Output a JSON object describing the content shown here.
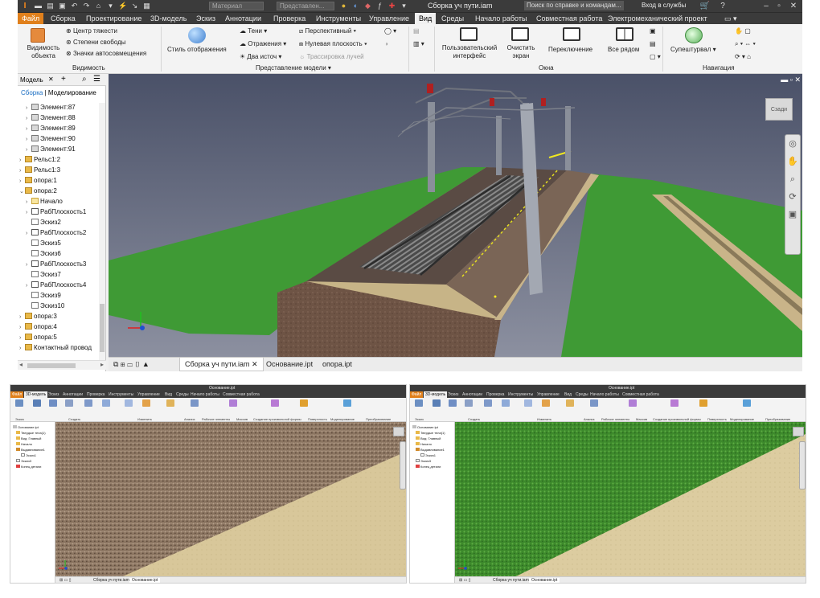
{
  "app": {
    "doc_title": "Сборка уч пути.iam",
    "search_placeholder": "Поиск по справке и командам...",
    "login": "Вход в службы",
    "material_dd": "Материал",
    "appearance_dd": "Представлен..."
  },
  "tabs": [
    "Файл",
    "Сборка",
    "Проектирование",
    "3D-модель",
    "Эскиз",
    "Аннотации",
    "Проверка",
    "Инструменты",
    "Управление",
    "Вид",
    "Среды",
    "Начало работы",
    "Совместная работа",
    "Электромеханический проект"
  ],
  "ribbon": {
    "visibility_object": "Видимость\nобъекта",
    "center_gravity": "Центр тяжести",
    "dof": "Степени свободы",
    "dof_icons": "Значки автосовмещения",
    "visibility_group": "Видимость",
    "display_style": "Стиль отображения",
    "shadows": "Тени",
    "reflections": "Отражения",
    "two_light": "Два источ",
    "perspective": "Перспективный",
    "ground_plane": "Нулевая плоскость",
    "ray_trace": "Трассировка лучей",
    "model_view_group": "Представление модели",
    "user_interface": "Пользовательский\nинтерфейс",
    "clean_screen": "Очистить\nэкран",
    "switch": "Переключение",
    "arrange_all": "Все рядом",
    "window_group": "Окна",
    "steering_wheel": "Супештурвал",
    "navigation_group": "Навигация"
  },
  "browser": {
    "tab_model": "Модель",
    "sub_assembly": "Сборка",
    "sub_modeling": "Моделирование",
    "items": [
      {
        "label": "Элемент:87",
        "indent": 2,
        "icon": "part",
        "exp": ">"
      },
      {
        "label": "Элемент:88",
        "indent": 2,
        "icon": "part",
        "exp": ">"
      },
      {
        "label": "Элемент:89",
        "indent": 2,
        "icon": "part",
        "exp": ">"
      },
      {
        "label": "Элемент:90",
        "indent": 2,
        "icon": "part",
        "exp": ">"
      },
      {
        "label": "Элемент:91",
        "indent": 2,
        "icon": "part",
        "exp": ">"
      },
      {
        "label": "Рельс1:2",
        "indent": 1,
        "icon": "folder",
        "exp": ">"
      },
      {
        "label": "Рельс1:3",
        "indent": 1,
        "icon": "folder",
        "exp": ">"
      },
      {
        "label": "опора:1",
        "indent": 1,
        "icon": "folder",
        "exp": ">"
      },
      {
        "label": "опора:2",
        "indent": 1,
        "icon": "folder",
        "exp": "v"
      },
      {
        "label": "Начало",
        "indent": 2,
        "icon": "origin",
        "exp": ">"
      },
      {
        "label": "РабПлоскость1",
        "indent": 2,
        "icon": "plane",
        "exp": ">"
      },
      {
        "label": "Эскиз2",
        "indent": 2,
        "icon": "sketch",
        "exp": ""
      },
      {
        "label": "РабПлоскость2",
        "indent": 2,
        "icon": "plane",
        "exp": ">"
      },
      {
        "label": "Эскиз5",
        "indent": 2,
        "icon": "sketch",
        "exp": ""
      },
      {
        "label": "Эскиз6",
        "indent": 2,
        "icon": "sketch",
        "exp": ""
      },
      {
        "label": "РабПлоскость3",
        "indent": 2,
        "icon": "plane",
        "exp": ">"
      },
      {
        "label": "Эскиз7",
        "indent": 2,
        "icon": "sketch",
        "exp": ""
      },
      {
        "label": "РабПлоскость4",
        "indent": 2,
        "icon": "plane",
        "exp": ">"
      },
      {
        "label": "Эскиз9",
        "indent": 2,
        "icon": "sketch",
        "exp": ""
      },
      {
        "label": "Эскиз10",
        "indent": 2,
        "icon": "sketch",
        "exp": ""
      },
      {
        "label": "опора:3",
        "indent": 1,
        "icon": "folder",
        "exp": ">"
      },
      {
        "label": "опора:4",
        "indent": 1,
        "icon": "folder",
        "exp": ">"
      },
      {
        "label": "опора:5",
        "indent": 1,
        "icon": "folder",
        "exp": ">"
      },
      {
        "label": "Контактный провод",
        "indent": 1,
        "icon": "folder",
        "exp": ">"
      }
    ]
  },
  "viewport": {
    "viewcube_label": "Сзади"
  },
  "doc_tabs": [
    "Сборка уч пути.iam",
    "Основание.ipt",
    "опора.ipt"
  ],
  "mini_left": {
    "title": "Основание.ipt",
    "tabs": [
      "Файл",
      "3D-модель",
      "Эскиз",
      "Аннотации",
      "Проверка",
      "Инструменты",
      "Управление",
      "Вид",
      "Среды",
      "Начало работы",
      "Совместная работа"
    ],
    "tree": [
      "Основание.ipt",
      "Твердые тела(1)",
      "Вид: Главный",
      "Начало",
      "Выдавливание1",
      "Эскиз1",
      "Эскиз3",
      "Конец детали"
    ],
    "doc_tabs": [
      "Сборка уч пути.iam",
      "Основание.ipt"
    ],
    "groups": [
      "Эскиз",
      "Создать",
      "Изменить",
      "Анализ",
      "Рабочие элементы",
      "Массив",
      "Создание произвольной формы",
      "Поверхность",
      "Моделирование",
      "Преобразование"
    ]
  },
  "mini_right": {
    "title": "Основание.ipt",
    "tabs": [
      "Файл",
      "3D-модель",
      "Эскиз",
      "Аннотации",
      "Проверка",
      "Инструменты",
      "Управление",
      "Вид",
      "Среды",
      "Начало работы",
      "Совместная работа"
    ],
    "tree": [
      "Основание.ipt",
      "Твердые тела(1)",
      "Вид: Главный",
      "Начало",
      "Выдавливание1",
      "Эскиз1",
      "Эскиз3",
      "Конец детали"
    ],
    "doc_tabs": [
      "Сборка уч пути.iam",
      "Основание.ipt"
    ],
    "groups": [
      "Эскиз",
      "Создать",
      "Изменить",
      "Анализ",
      "Рабочие элементы",
      "Массив",
      "Создание произвольной формы",
      "Поверхность",
      "Моделирование",
      "Преобразование"
    ]
  },
  "colors": {
    "accent": "#e0801c",
    "titlebar": "#3b3b3b",
    "grass": "#3f9a35",
    "gravel": "#6e5445",
    "ballast_dark": "#4a3a32",
    "sky_top": "#4a5168",
    "sky_bottom": "#8c90a0"
  }
}
